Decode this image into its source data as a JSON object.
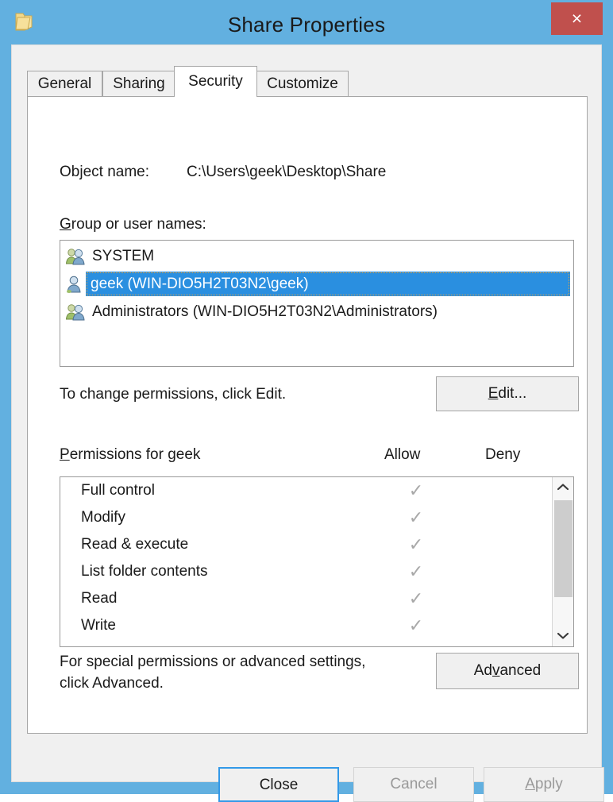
{
  "window": {
    "title": "Share Properties",
    "icon": "folder-icon",
    "close_label": "×",
    "accent_blue": "#62b0e0",
    "close_red": "#c0504d",
    "selection_blue": "#2a8fe0"
  },
  "tabs": [
    {
      "label": "General",
      "active": false
    },
    {
      "label": "Sharing",
      "active": false
    },
    {
      "label": "Security",
      "active": true
    },
    {
      "label": "Customize",
      "active": false
    }
  ],
  "security": {
    "object_name_label": "Object name:",
    "object_name_value": "C:\\Users\\geek\\Desktop\\Share",
    "group_label": "Group or user names:",
    "groups": [
      {
        "name": "SYSTEM",
        "icon": "group-users-icon",
        "selected": false
      },
      {
        "name": "geek (WIN-DIO5H2T03N2\\geek)",
        "icon": "single-user-icon",
        "selected": true
      },
      {
        "name": "Administrators (WIN-DIO5H2T03N2\\Administrators)",
        "icon": "group-users-icon",
        "selected": false
      }
    ],
    "edit_hint": "To change permissions, click Edit.",
    "edit_button": "Edit...",
    "permissions_header": "Permissions for geek",
    "allow_header": "Allow",
    "deny_header": "Deny",
    "check_glyph": "✓",
    "permissions": [
      {
        "name": "Full control",
        "allow": true,
        "deny": false
      },
      {
        "name": "Modify",
        "allow": true,
        "deny": false
      },
      {
        "name": "Read & execute",
        "allow": true,
        "deny": false
      },
      {
        "name": "List folder contents",
        "allow": true,
        "deny": false
      },
      {
        "name": "Read",
        "allow": true,
        "deny": false
      },
      {
        "name": "Write",
        "allow": true,
        "deny": false
      }
    ],
    "scroll_up_glyph": "⌃",
    "scroll_down_glyph": "⌄",
    "advanced_hint_line1": "For special permissions or advanced settings,",
    "advanced_hint_line2": "click Advanced.",
    "advanced_button": "Advanced"
  },
  "footer": {
    "close_label": "Close",
    "cancel_label": "Cancel",
    "apply_label": "Apply"
  }
}
